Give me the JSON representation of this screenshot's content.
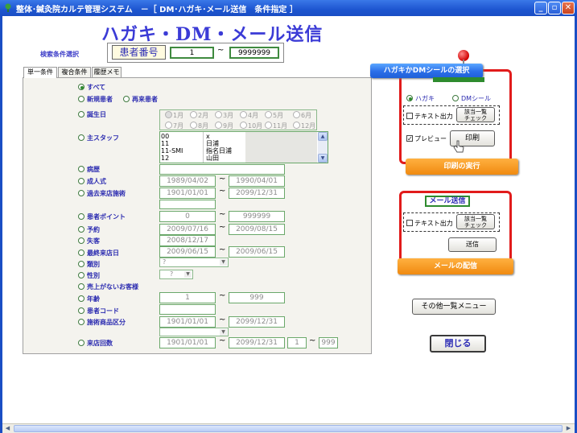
{
  "window": {
    "title": "整体･鍼灸院カルテ管理システム　－［ DM･ハガキ･メール送信　条件指定 ］",
    "minimize": "_",
    "maximize": "▫",
    "close": "✕"
  },
  "headline": "ハガキ・DM・メール送信",
  "search": {
    "label": "検索条件選択",
    "patient_label": "患者番号",
    "from": "1",
    "tilde": "~",
    "to": "9999999"
  },
  "tabs": [
    "単一条件",
    "複合条件",
    "履歴メモ"
  ],
  "conditions": {
    "all": "すべて",
    "new": "新規患者",
    "returning": "再来患者",
    "birthday": "誕生日",
    "months": [
      "1月",
      "2月",
      "3月",
      "4月",
      "5月",
      "6月",
      "7月",
      "8月",
      "9月",
      "10月",
      "11月",
      "12月"
    ],
    "staff": "主スタッフ",
    "staff_list": [
      {
        "code": "00",
        "name": "x"
      },
      {
        "code": "11",
        "name": "日浦"
      },
      {
        "code": "11-SMI",
        "name": "指名日浦"
      },
      {
        "code": "12",
        "name": "山田"
      }
    ],
    "medical_history": "病歴",
    "coming_of_age": "成人式",
    "coming_of_age_from": "1989/04/02",
    "coming_of_age_to": "1990/04/01",
    "past_treatment": "過去来店施術",
    "past_treatment_from": "1901/01/01",
    "past_treatment_to": "2099/12/31",
    "points": "患者ポイント",
    "points_from": "0",
    "points_to": "999999",
    "reservation": "予約",
    "reservation_from": "2009/07/16",
    "reservation_to": "2009/08/15",
    "lapsed": "失客",
    "lapsed_date": "2008/12/17",
    "last_visit": "最終来店日",
    "last_visit_from": "2009/06/15",
    "last_visit_to": "2009/06/15",
    "category": "類別",
    "category_value": "?",
    "gender": "性別",
    "gender_value": "?",
    "no_sales": "売上がないお客様",
    "age": "年齢",
    "age_from": "1",
    "age_to": "999",
    "patient_code": "患者コード",
    "treatment_product": "施術商品区分",
    "treatment_product_from": "1901/01/01",
    "treatment_product_to": "2099/12/31",
    "visit_count": "来店回数",
    "visit_count_date_from": "1901/01/01",
    "visit_count_date_to": "2099/12/31",
    "visit_count_from": "1",
    "visit_count_to": "999"
  },
  "dm_panel": {
    "callout_select": "ハガキかDMシールの選択",
    "postcard": "ハガキ",
    "dm_seal": "DMシール",
    "text_output": "テキスト出力",
    "list_check_1": "該当一覧",
    "list_check_2": "チェック",
    "preview": "プレビュー",
    "print": "印刷",
    "callout_print": "印刷の実行"
  },
  "mail_panel": {
    "title": "メール送信",
    "text_output": "テキスト出力",
    "list_check_1": "該当一覧",
    "list_check_2": "チェック",
    "send": "送信",
    "callout_send": "メールの配信"
  },
  "other_menu": "その他一覧メニュー",
  "close_button": "閉じる",
  "colors": {
    "accent": "#3b3bd6",
    "red_frame": "#e11b1b",
    "callout_blue": "#2b6ee8",
    "callout_orange": "#f08a10",
    "field_border": "#6aa86a"
  }
}
